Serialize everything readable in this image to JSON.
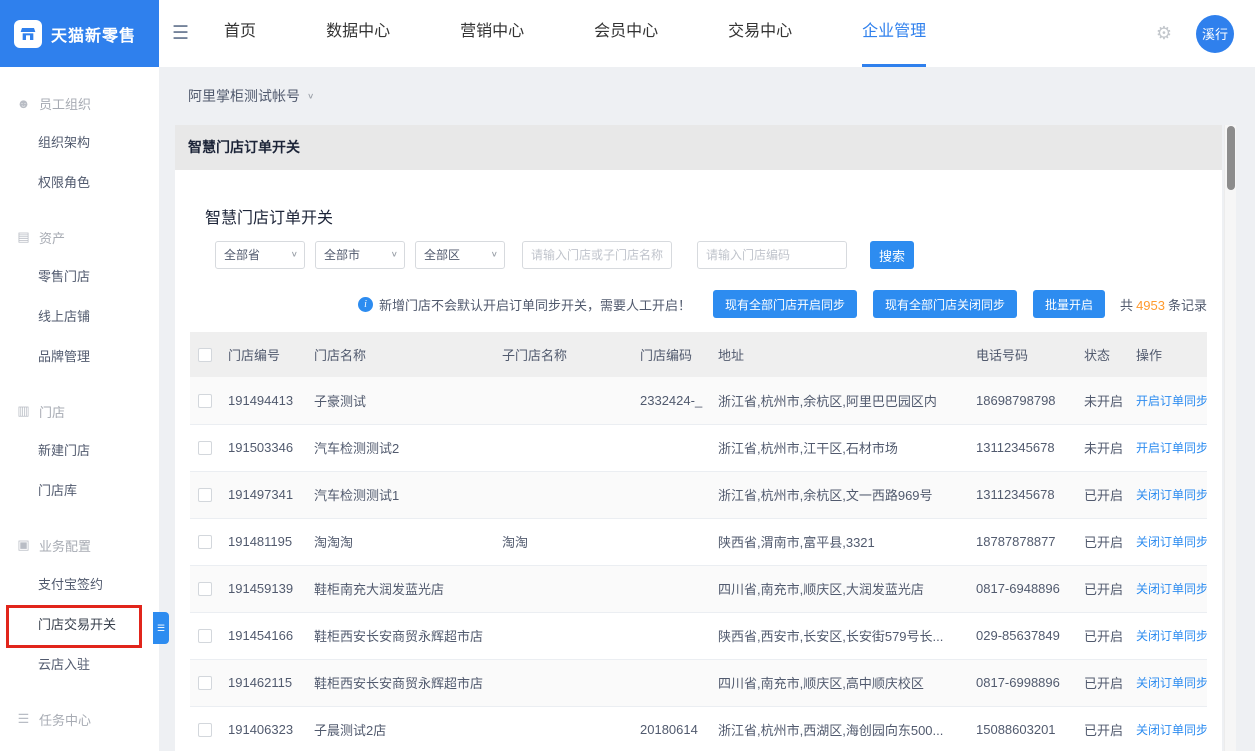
{
  "colors": {
    "brand_blue": "#2f80ed",
    "link_blue": "#2d8cf0",
    "count_orange": "#ff9a2e",
    "annotation_red": "#e1251b"
  },
  "header": {
    "logo_text": "天猫新零售",
    "nav": [
      {
        "label": "首页",
        "active": false
      },
      {
        "label": "数据中心",
        "active": false
      },
      {
        "label": "营销中心",
        "active": false
      },
      {
        "label": "会员中心",
        "active": false
      },
      {
        "label": "交易中心",
        "active": false
      },
      {
        "label": "企业管理",
        "active": true
      }
    ],
    "avatar_text": "溪行"
  },
  "sidebar": {
    "entries": [
      {
        "cls": "nav-group",
        "label": "员工组织",
        "icon": "☻",
        "icon_name": "members-icon"
      },
      {
        "cls": "nav-item",
        "label": "组织架构"
      },
      {
        "cls": "nav-item",
        "label": "权限角色"
      },
      {
        "cls": "nav-group",
        "label": "资产",
        "icon": "▤",
        "icon_name": "assets-icon"
      },
      {
        "cls": "nav-item",
        "label": "零售门店"
      },
      {
        "cls": "nav-item",
        "label": "线上店铺"
      },
      {
        "cls": "nav-item",
        "label": "品牌管理"
      },
      {
        "cls": "nav-group",
        "label": "门店",
        "icon": "▥",
        "icon_name": "stores-icon"
      },
      {
        "cls": "nav-item",
        "label": "新建门店"
      },
      {
        "cls": "nav-item",
        "label": "门店库"
      },
      {
        "cls": "nav-group",
        "label": "业务配置",
        "icon": "▣",
        "icon_name": "business-config-icon"
      },
      {
        "cls": "nav-item",
        "label": "支付宝签约"
      },
      {
        "cls": "nav-item highlighted",
        "label": "门店交易开关",
        "highlighted": true
      },
      {
        "cls": "nav-item",
        "label": "云店入驻"
      },
      {
        "cls": "nav-group",
        "label": "任务中心",
        "icon": "☰",
        "icon_name": "tasks-icon"
      }
    ]
  },
  "main": {
    "account_selector": "阿里掌柜测试帐号",
    "panel_title": "智慧门店订单开关",
    "card_title": "智慧门店订单开关",
    "filters": {
      "province": "全部省",
      "city": "全部市",
      "district": "全部区",
      "name_placeholder": "请输入门店或子门店名称",
      "code_placeholder": "请输入门店编码",
      "search_label": "搜索"
    },
    "notice": {
      "text": "新增门店不会默认开启订单同步开关，需要人工开启！",
      "open_all_label": "现有全部门店开启同步",
      "close_all_label": "现有全部门店关闭同步",
      "batch_open_label": "批量开启",
      "total_prefix": "共",
      "total_count": "4953",
      "total_suffix": "条记录"
    },
    "table": {
      "columns": [
        "门店编号",
        "门店名称",
        "子门店名称",
        "门店编码",
        "地址",
        "电话号码",
        "状态",
        "操作"
      ],
      "rows": [
        {
          "id": "191494413",
          "name": "子豪测试",
          "sub_name": "",
          "code": "2332424-_",
          "address": "浙江省,杭州市,余杭区,阿里巴巴园区内",
          "phone": "18698798798",
          "status": "未开启",
          "action": "开启订单同步"
        },
        {
          "id": "191503346",
          "name": "汽车检测测试2",
          "sub_name": "",
          "code": "",
          "address": "浙江省,杭州市,江干区,石材市场",
          "phone": "13112345678",
          "status": "未开启",
          "action": "开启订单同步"
        },
        {
          "id": "191497341",
          "name": "汽车检测测试1",
          "sub_name": "",
          "code": "",
          "address": "浙江省,杭州市,余杭区,文一西路969号",
          "phone": "13112345678",
          "status": "已开启",
          "action": "关闭订单同步"
        },
        {
          "id": "191481195",
          "name": "淘淘淘",
          "sub_name": "淘淘",
          "code": "",
          "address": "陕西省,渭南市,富平县,3321",
          "phone": "18787878877",
          "status": "已开启",
          "action": "关闭订单同步"
        },
        {
          "id": "191459139",
          "name": "鞋柜南充大润发蓝光店",
          "sub_name": "",
          "code": "",
          "address": "四川省,南充市,顺庆区,大润发蓝光店",
          "phone": "0817-6948896",
          "status": "已开启",
          "action": "关闭订单同步"
        },
        {
          "id": "191454166",
          "name": "鞋柜西安长安商贸永辉超市店",
          "sub_name": "",
          "code": "",
          "address": "陕西省,西安市,长安区,长安街579号长...",
          "phone": "029-85637849",
          "status": "已开启",
          "action": "关闭订单同步"
        },
        {
          "id": "191462115",
          "name": "鞋柜西安长安商贸永辉超市店",
          "sub_name": "",
          "code": "",
          "address": "四川省,南充市,顺庆区,高中顺庆校区",
          "phone": "0817-6998896",
          "status": "已开启",
          "action": "关闭订单同步"
        },
        {
          "id": "191406323",
          "name": "子晨测试2店",
          "sub_name": "",
          "code": "20180614",
          "address": "浙江省,杭州市,西湖区,海创园向东500...",
          "phone": "15088603201",
          "status": "已开启",
          "action": "关闭订单同步"
        }
      ]
    }
  }
}
